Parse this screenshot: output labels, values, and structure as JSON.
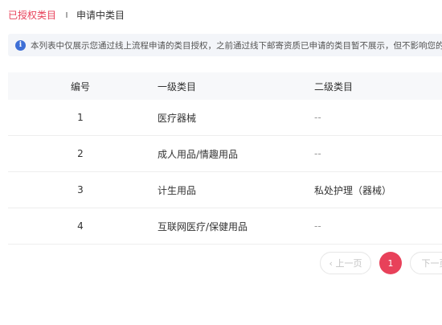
{
  "tabs": [
    {
      "label": "已授权类目"
    },
    {
      "label": "申请中类目"
    }
  ],
  "notice": {
    "icon": "info-icon",
    "icon_glyph": "i",
    "text": "本列表中仅展示您通过线上流程申请的类目授权，之前通过线下邮寄资质已申请的类目暂不展示，但不影响您的类目授权"
  },
  "table": {
    "headers": [
      "编号",
      "一级类目",
      "二级类目"
    ],
    "rows": [
      {
        "id": "1",
        "primary": "医疗器械",
        "secondary": "--"
      },
      {
        "id": "2",
        "primary": "成人用品/情趣用品",
        "secondary": "--"
      },
      {
        "id": "3",
        "primary": "计生用品",
        "secondary": "私处护理（器械）"
      },
      {
        "id": "4",
        "primary": "互联网医疗/保健用品",
        "secondary": "--"
      }
    ]
  },
  "pagination": {
    "prev_label": "‹ 上一页",
    "current_page": "1",
    "next_label": "下一页"
  },
  "colors": {
    "accent": "#e8415a",
    "info": "#3e6fd6"
  }
}
